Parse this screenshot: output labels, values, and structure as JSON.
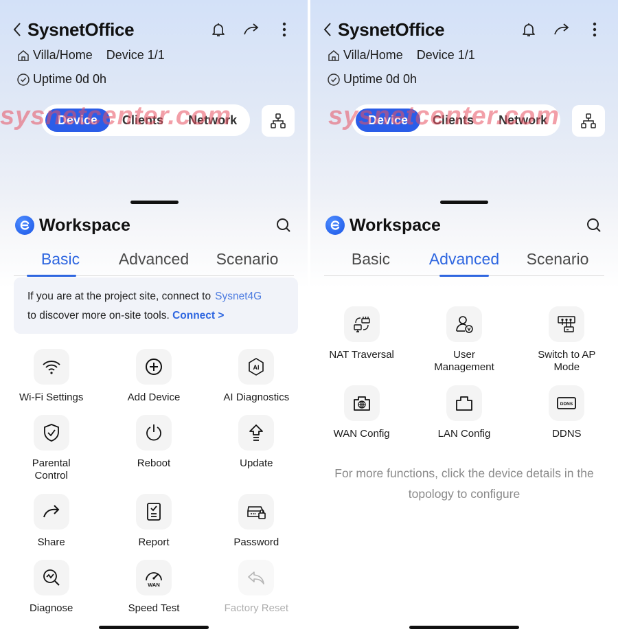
{
  "screens": [
    {
      "header": {
        "title": "SysnetOffice",
        "location": "Villa/Home",
        "device_count": "Device 1/1",
        "uptime": "Uptime 0d 0h",
        "icons": [
          "back-chevron-icon",
          "bell-icon",
          "share-arrow-icon",
          "more-vertical-icon"
        ]
      },
      "segments": [
        {
          "label": "Device",
          "active": true
        },
        {
          "label": "Clients",
          "active": false
        },
        {
          "label": "Network",
          "active": false
        }
      ],
      "topology_icon": "topology-icon",
      "watermark": "sysnetcenter.com",
      "workspace": {
        "title": "Workspace",
        "tabs": [
          {
            "label": "Basic",
            "active": true
          },
          {
            "label": "Advanced",
            "active": false
          },
          {
            "label": "Scenario",
            "active": false
          }
        ],
        "notice": {
          "text1": "If you are at the project site, connect to",
          "ssid": "Sysnet4G",
          "text2": "to discover more on-site tools.",
          "link": "Connect >"
        },
        "tools": [
          {
            "label": "Wi-Fi Settings",
            "icon": "wifi-icon"
          },
          {
            "label": "Add Device",
            "icon": "add-circle-icon"
          },
          {
            "label": "AI Diagnostics",
            "icon": "ai-diagnostics-icon"
          },
          {
            "label": "Parental Control",
            "icon": "shield-check-icon"
          },
          {
            "label": "Reboot",
            "icon": "power-icon"
          },
          {
            "label": "Update",
            "icon": "upgrade-arrow-icon"
          },
          {
            "label": "Share",
            "icon": "share-arrow-icon"
          },
          {
            "label": "Report",
            "icon": "report-icon"
          },
          {
            "label": "Password",
            "icon": "router-lock-icon"
          },
          {
            "label": "Diagnose",
            "icon": "diagnose-icon"
          },
          {
            "label": "Speed Test",
            "icon": "speedometer-icon"
          },
          {
            "label": "Factory Reset",
            "icon": "undo-icon",
            "disabled": true
          }
        ]
      }
    },
    {
      "header": {
        "title": "SysnetOffice",
        "location": "Villa/Home",
        "device_count": "Device 1/1",
        "uptime": "Uptime 0d 0h",
        "icons": [
          "back-chevron-icon",
          "bell-icon",
          "share-arrow-icon",
          "more-vertical-icon"
        ]
      },
      "segments": [
        {
          "label": "Device",
          "active": true
        },
        {
          "label": "Clients",
          "active": false
        },
        {
          "label": "Network",
          "active": false
        }
      ],
      "topology_icon": "topology-icon",
      "watermark": "sysnetcenter.com",
      "workspace": {
        "title": "Workspace",
        "tabs": [
          {
            "label": "Basic",
            "active": false
          },
          {
            "label": "Advanced",
            "active": true
          },
          {
            "label": "Scenario",
            "active": false
          }
        ],
        "tools": [
          {
            "label": "NAT Traversal",
            "icon": "nat-traversal-icon"
          },
          {
            "label": "User Management",
            "icon": "user-management-icon"
          },
          {
            "label": "Switch to AP Mode",
            "icon": "ap-mode-icon"
          },
          {
            "label": "WAN Config",
            "icon": "wan-port-icon"
          },
          {
            "label": "LAN Config",
            "icon": "lan-port-icon"
          },
          {
            "label": "DDNS",
            "icon": "ddns-icon"
          }
        ],
        "hint": "For more functions, click the device details in the topology to configure"
      }
    }
  ]
}
